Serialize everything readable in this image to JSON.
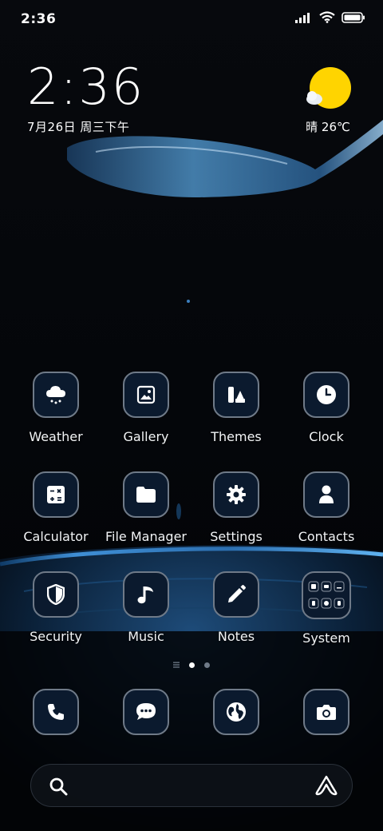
{
  "status_bar": {
    "time": "2:36"
  },
  "clock_widget": {
    "time": "2:36",
    "date": "7月26日 周三下午"
  },
  "weather_widget": {
    "condition": "晴",
    "temperature": "26℃",
    "text": "晴 26℃",
    "sun_color": "#FFD400"
  },
  "apps": [
    {
      "label": "Weather",
      "icon": "weather-icon"
    },
    {
      "label": "Gallery",
      "icon": "gallery-icon"
    },
    {
      "label": "Themes",
      "icon": "themes-icon"
    },
    {
      "label": "Clock",
      "icon": "clock-icon"
    },
    {
      "label": "Calculator",
      "icon": "calculator-icon"
    },
    {
      "label": "File Manager",
      "icon": "folder-icon"
    },
    {
      "label": "Settings",
      "icon": "gear-icon"
    },
    {
      "label": "Contacts",
      "icon": "person-icon"
    },
    {
      "label": "Security",
      "icon": "shield-icon"
    },
    {
      "label": "Music",
      "icon": "music-note-icon"
    },
    {
      "label": "Notes",
      "icon": "pencil-icon"
    },
    {
      "label": "System",
      "icon": "folder-grid-icon"
    }
  ],
  "page_indicator": {
    "pages": 2,
    "current": 1
  },
  "dock": [
    {
      "name": "phone",
      "icon": "phone-icon"
    },
    {
      "name": "messages",
      "icon": "chat-icon"
    },
    {
      "name": "browser",
      "icon": "globe-icon"
    },
    {
      "name": "camera",
      "icon": "camera-icon"
    }
  ],
  "search_bar": {
    "left_icon": "search-icon",
    "right_icon": "assistant-icon"
  },
  "colors": {
    "tile_bg": "#0B1A2E",
    "tile_border": "#6F7A88",
    "accent_blue": "#2E8CD6"
  }
}
